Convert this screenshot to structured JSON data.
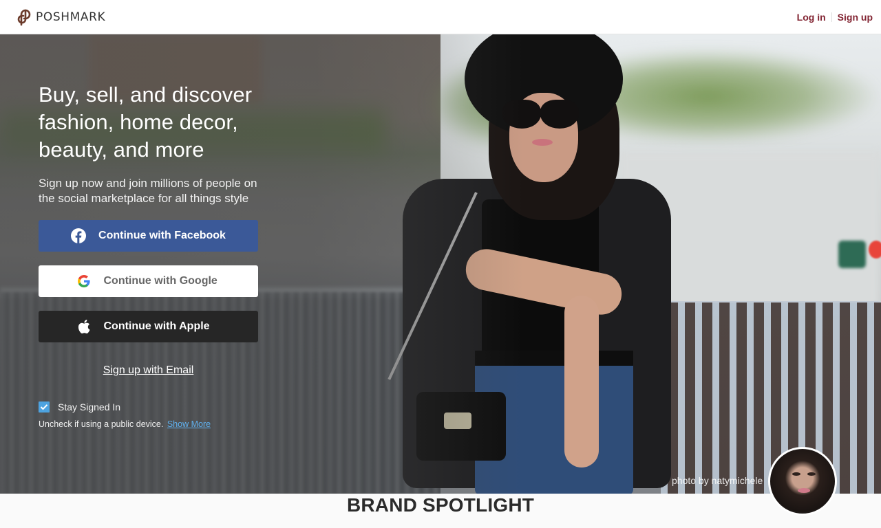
{
  "header": {
    "brand_name": "POSHMARK",
    "logo_icon": "poshmark-logo-icon",
    "login_label": "Log in",
    "signup_label": "Sign up",
    "link_color": "#822432"
  },
  "hero": {
    "headline_lines": [
      "Buy, sell, and discover",
      "fashion, home decor,",
      "beauty, and more"
    ],
    "subhead": "Sign up now and join millions of people on the social marketplace for all things style",
    "buttons": [
      {
        "id": "facebook",
        "label": "Continue with Facebook",
        "icon": "facebook-icon",
        "bg": "#3b5998"
      },
      {
        "id": "google",
        "label": "Continue with Google",
        "icon": "google-icon",
        "bg": "#ffffff"
      },
      {
        "id": "apple",
        "label": "Continue with Apple",
        "icon": "apple-icon",
        "bg": "#262626"
      }
    ],
    "email_link": "Sign up with Email",
    "stay_signed_in": {
      "label": "Stay Signed In",
      "checked": true,
      "hint": "Uncheck if using a public device.",
      "show_more": "Show More"
    },
    "photo_credit": "photo by natymichele"
  },
  "spotlight": {
    "title": "BRAND SPOTLIGHT"
  }
}
